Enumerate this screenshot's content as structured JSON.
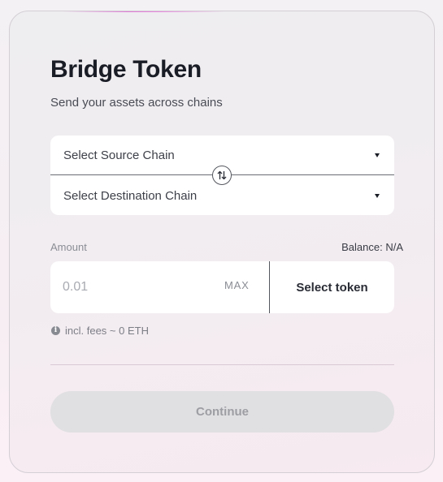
{
  "header": {
    "title": "Bridge Token",
    "subtitle": "Send your assets across chains"
  },
  "chains": {
    "source_placeholder": "Select Source Chain",
    "destination_placeholder": "Select Destination Chain",
    "swap_icon": "swap-vertical-icon"
  },
  "amount": {
    "label": "Amount",
    "balance_label": "Balance: N/A",
    "placeholder": "0.01",
    "value": "",
    "max_label": "MAX",
    "token_button_label": "Select token"
  },
  "fees": {
    "text": "incl. fees ~ 0 ETH",
    "icon": "info-icon"
  },
  "actions": {
    "continue_label": "Continue",
    "continue_enabled": false
  },
  "colors": {
    "title": "#1b1d26",
    "accent_glow": "#e07ad8",
    "button_disabled_bg": "#e0dfe1",
    "button_disabled_text": "#9d9ea4"
  }
}
